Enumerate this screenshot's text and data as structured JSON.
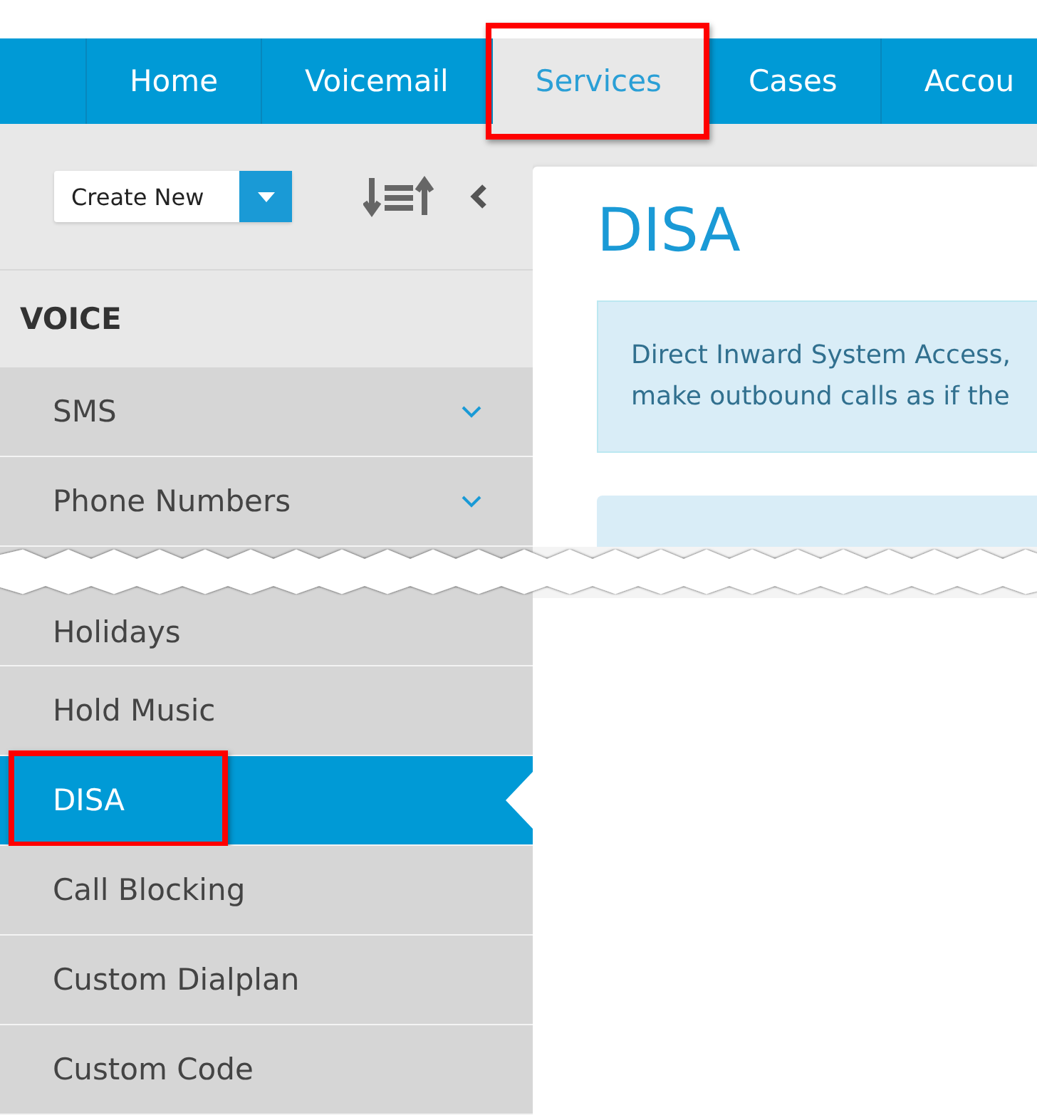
{
  "nav": {
    "items": [
      {
        "label": "Home",
        "selected": false,
        "highlighted": false
      },
      {
        "label": "Voicemail",
        "selected": false,
        "highlighted": false
      },
      {
        "label": "Services",
        "selected": true,
        "highlighted": true
      },
      {
        "label": "Cases",
        "selected": false,
        "highlighted": false
      },
      {
        "label": "Accou",
        "selected": false,
        "highlighted": false
      }
    ]
  },
  "toolbar": {
    "create_button": "Create New"
  },
  "sidebar": {
    "section": "VOICE",
    "items_above": [
      {
        "label": "SMS",
        "expandable": true,
        "selected": false,
        "highlighted": false
      },
      {
        "label": "Phone Numbers",
        "expandable": true,
        "selected": false,
        "highlighted": false
      }
    ],
    "items_below": [
      {
        "label": "Holidays",
        "expandable": false,
        "selected": false,
        "highlighted": false
      },
      {
        "label": "Hold Music",
        "expandable": false,
        "selected": false,
        "highlighted": false
      },
      {
        "label": "DISA",
        "expandable": false,
        "selected": true,
        "highlighted": true
      },
      {
        "label": "Call Blocking",
        "expandable": false,
        "selected": false,
        "highlighted": false
      },
      {
        "label": "Custom Dialplan",
        "expandable": false,
        "selected": false,
        "highlighted": false
      },
      {
        "label": "Custom Code",
        "expandable": false,
        "selected": false,
        "highlighted": false
      }
    ]
  },
  "content": {
    "title": "DISA",
    "info_lines": [
      "Direct Inward System Access,",
      "make outbound calls as if the"
    ]
  }
}
